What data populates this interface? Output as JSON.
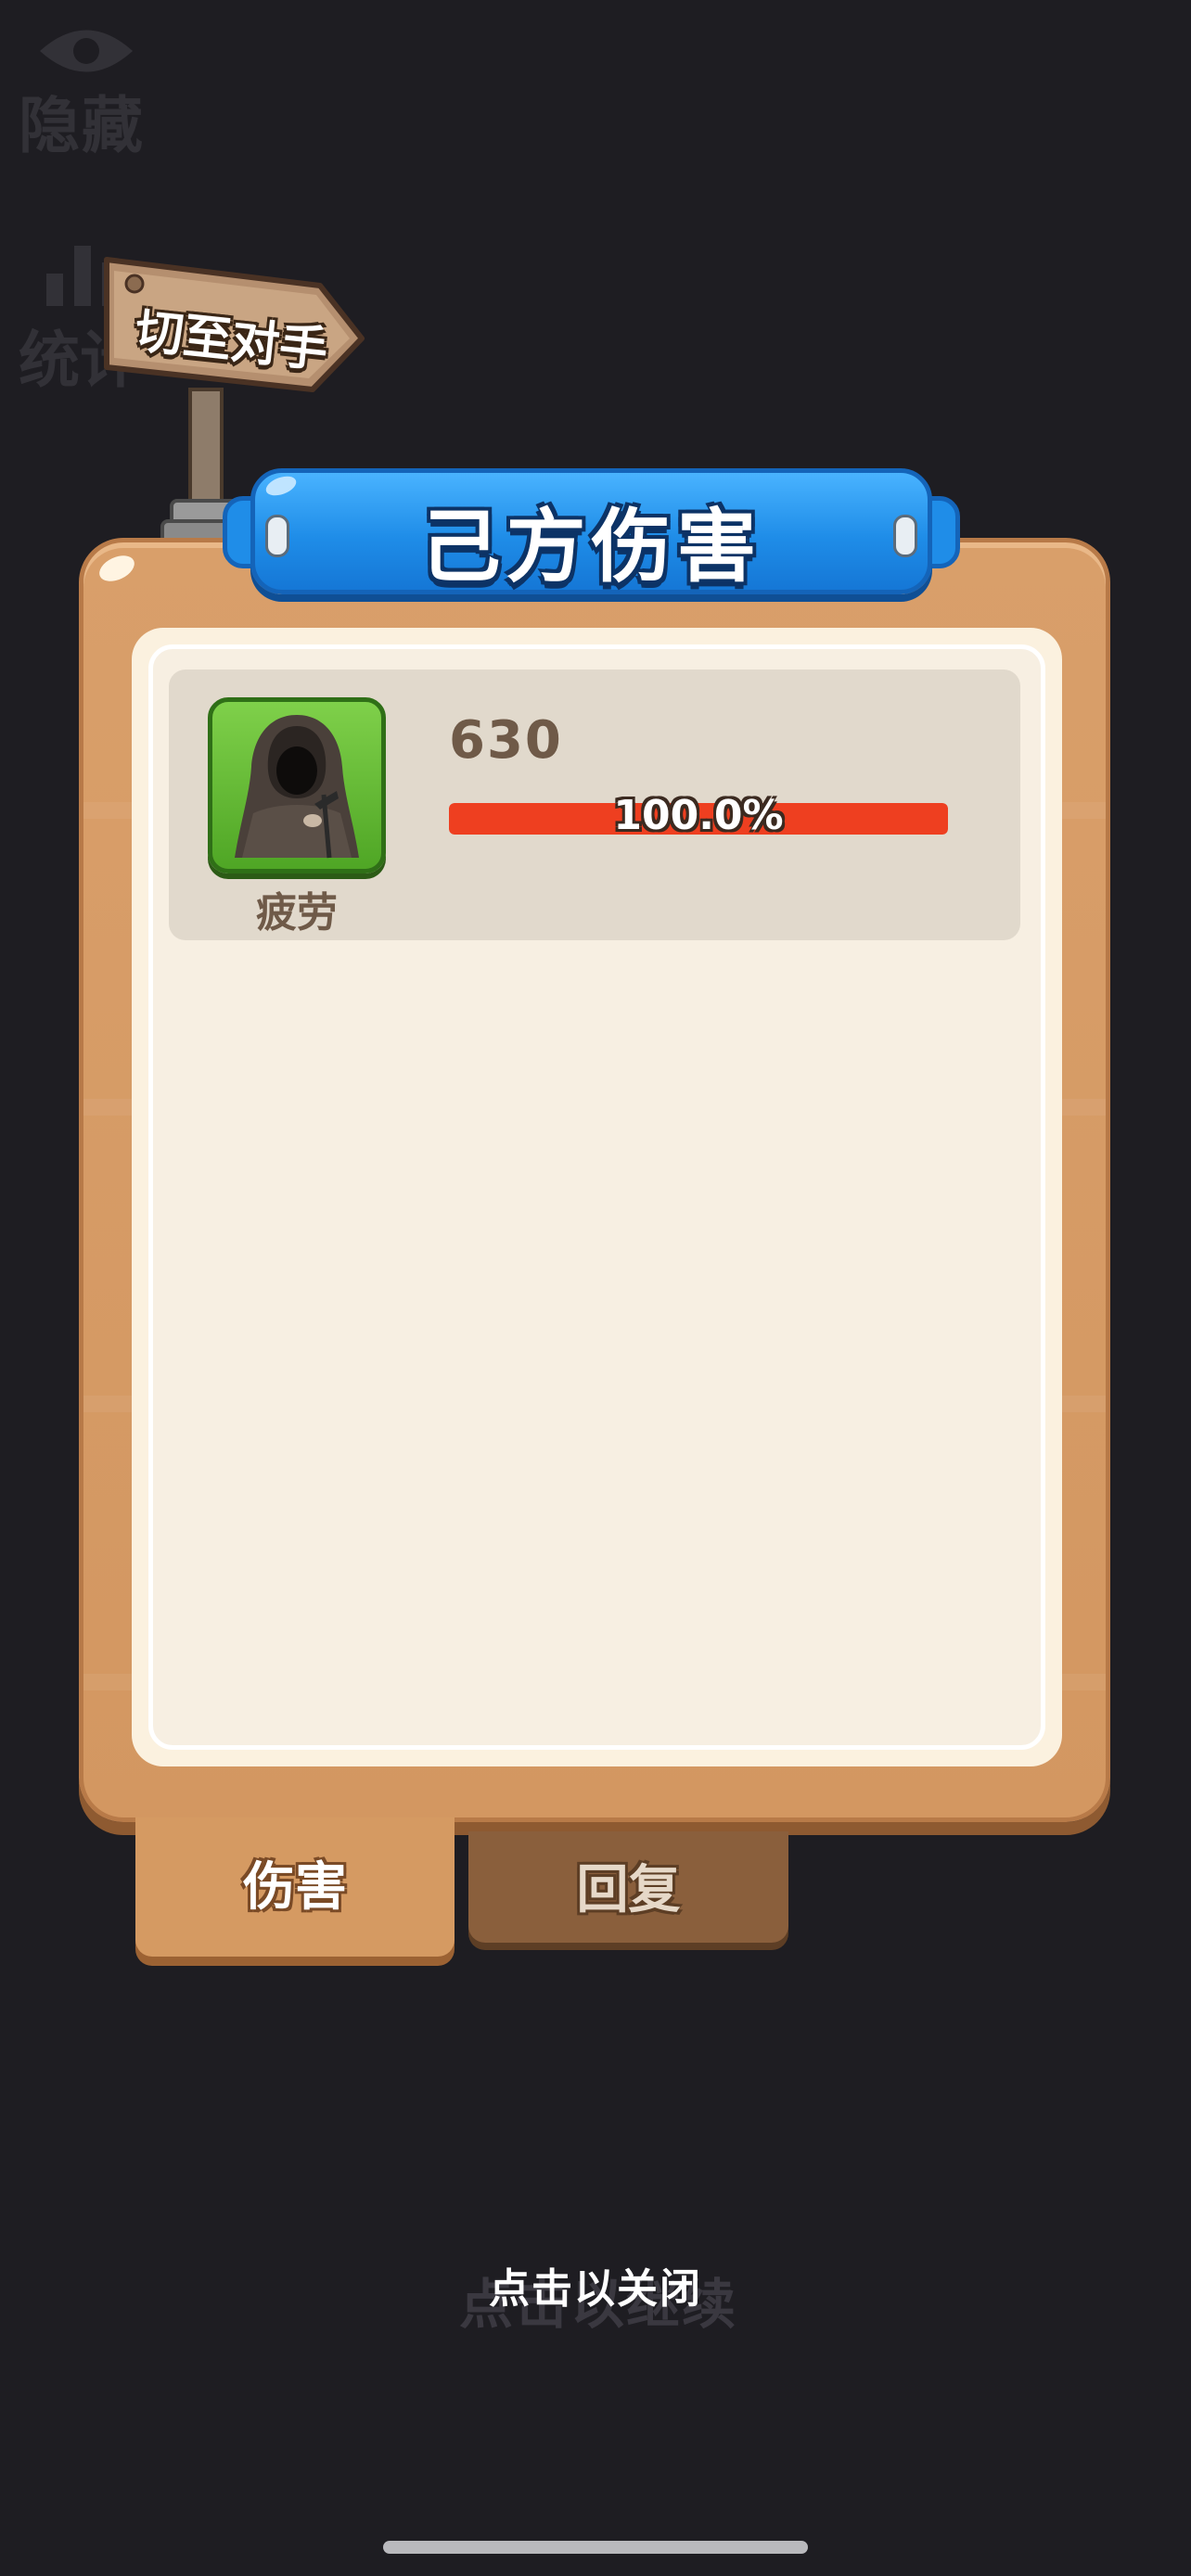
{
  "background": {
    "hide_label": "隐藏",
    "stats_label": "统计",
    "continue_label": "点击以继续"
  },
  "signpost": {
    "label": "切至对手"
  },
  "panel": {
    "title": "己方伤害",
    "rows": [
      {
        "name": "疲劳",
        "value": "630",
        "percent_text": "100.0%",
        "percent": 100.0,
        "icon": "hooded-reaper-icon"
      }
    ]
  },
  "tabs": [
    {
      "label": "伤害",
      "active": true
    },
    {
      "label": "回复",
      "active": false
    }
  ],
  "close_hint": "点击以关闭",
  "colors": {
    "background": "#1e1d22",
    "banner_blue": "#1f8de8",
    "board_wood": "#d39761",
    "bar_red": "#ee3f20",
    "avatar_green": "#4fa625"
  }
}
